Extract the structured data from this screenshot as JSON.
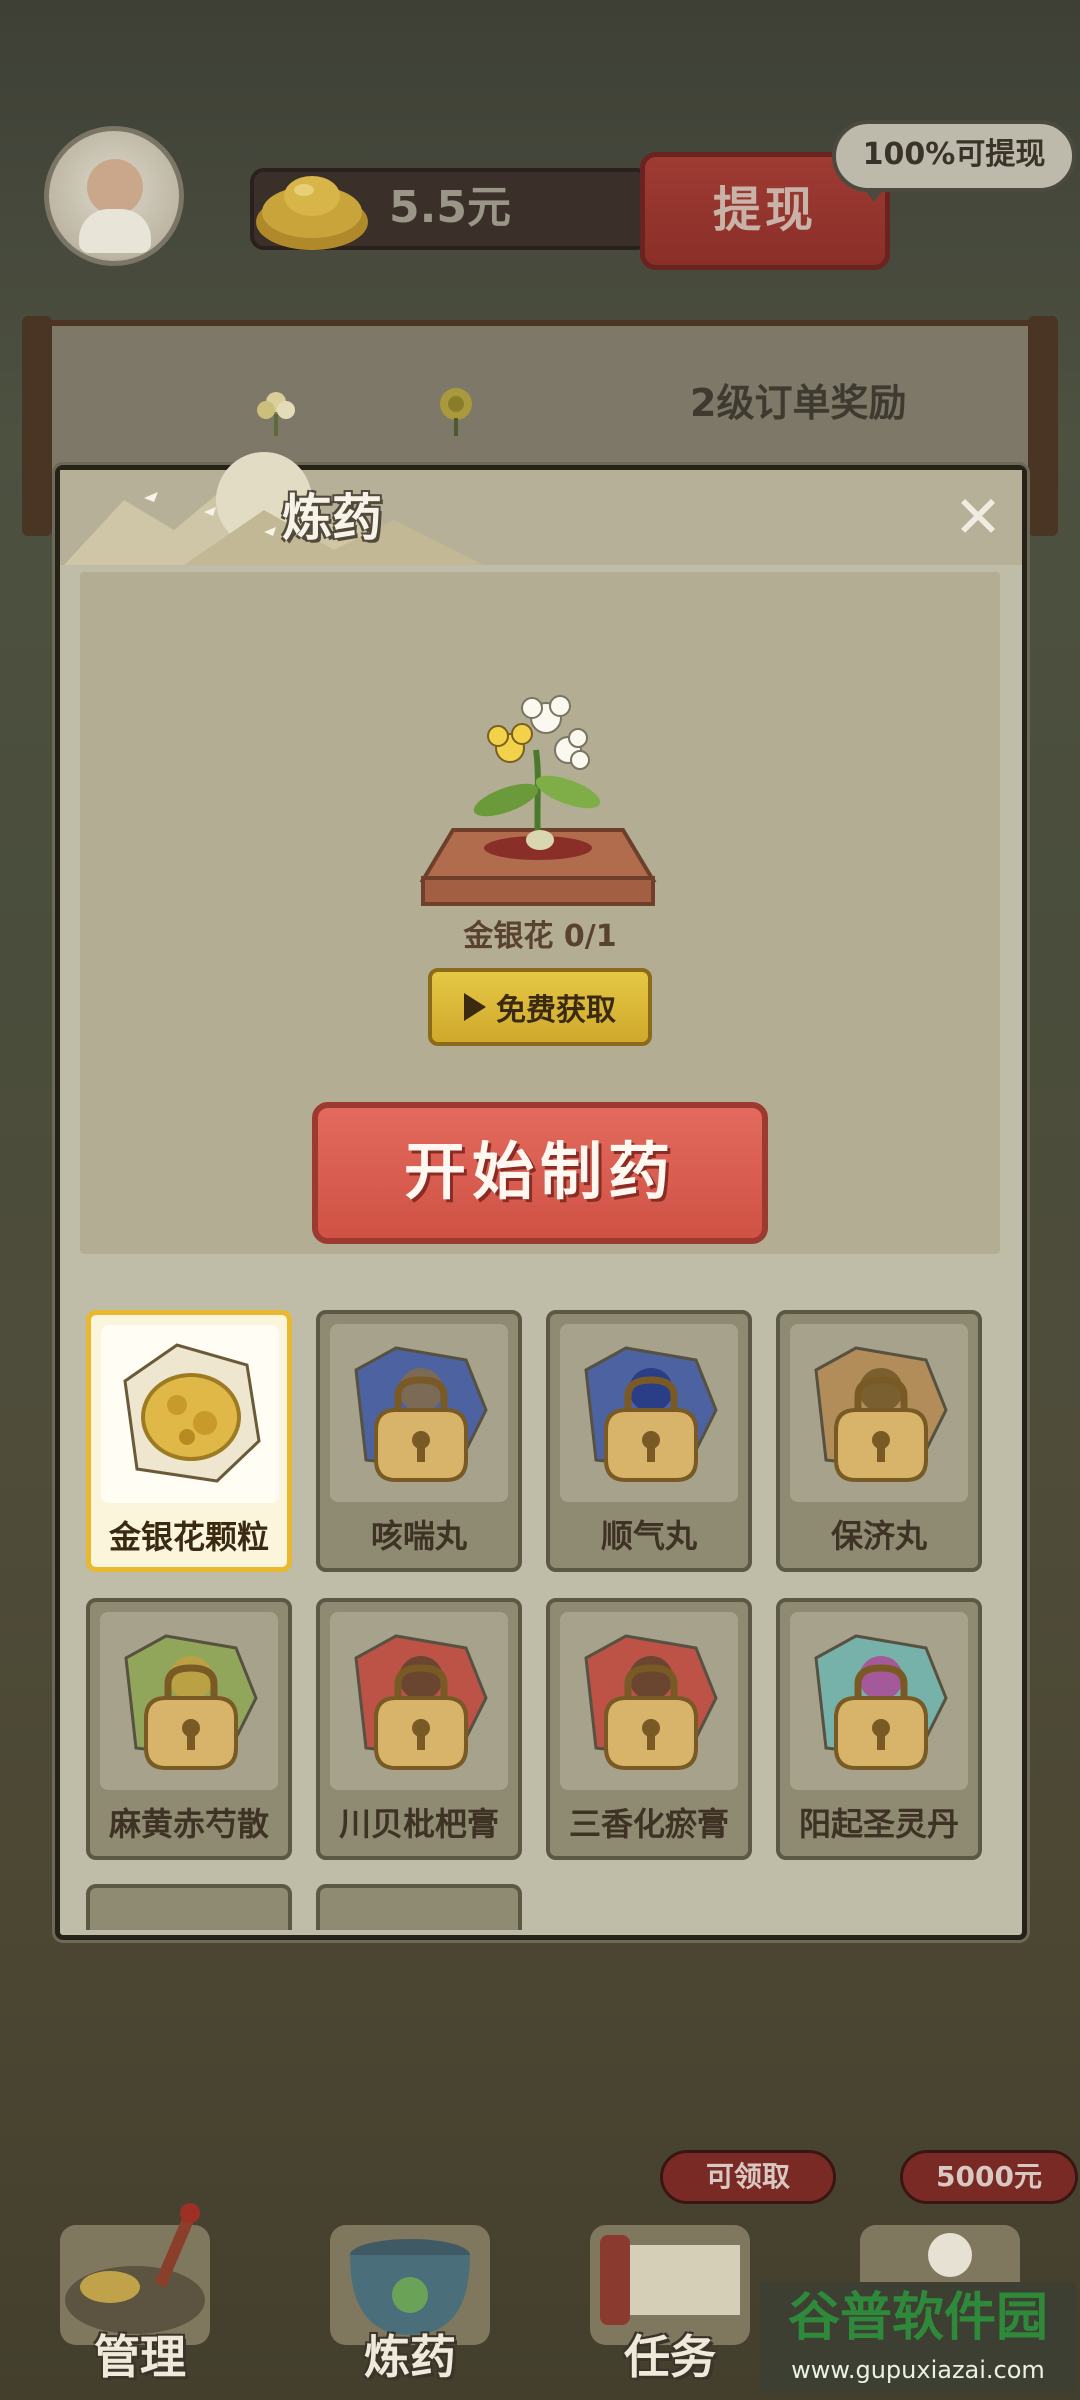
{
  "top_bar": {
    "balance": "5.5元",
    "withdraw_label": "提现",
    "withdraw_tip": "100%可提现"
  },
  "order_board": {
    "reward_label": "2级订单奖励"
  },
  "dialog": {
    "title": "炼药",
    "close_icon": "close-icon",
    "ingredient": {
      "name": "金银花",
      "progress": "0/1"
    },
    "ingredient_status": "金银花 0/1",
    "free_get_label": "免费获取",
    "start_button_label": "开始制药"
  },
  "medicines": [
    {
      "name": "金银花颗粒",
      "selected": true,
      "locked": false
    },
    {
      "name": "咳喘丸",
      "selected": false,
      "locked": true
    },
    {
      "name": "顺气丸",
      "selected": false,
      "locked": true
    },
    {
      "name": "保济丸",
      "selected": false,
      "locked": true
    },
    {
      "name": "麻黄赤芍散",
      "selected": false,
      "locked": true
    },
    {
      "name": "川贝枇杷膏",
      "selected": false,
      "locked": true
    },
    {
      "name": "三香化瘀膏",
      "selected": false,
      "locked": true
    },
    {
      "name": "阳起圣灵丹",
      "selected": false,
      "locked": true
    }
  ],
  "bottom_nav": {
    "manage_label": "管理",
    "alchemy_label": "炼药",
    "task_label": "任务",
    "task_badge": "可领取",
    "fourth_badge": "5000元"
  },
  "watermark": {
    "title": "谷普软件园",
    "url": "www.gupuxiazai.com"
  },
  "colors": {
    "accent_red": "#cf5244",
    "accent_gold": "#e8b830",
    "dialog_bg": "#bfbda8"
  }
}
